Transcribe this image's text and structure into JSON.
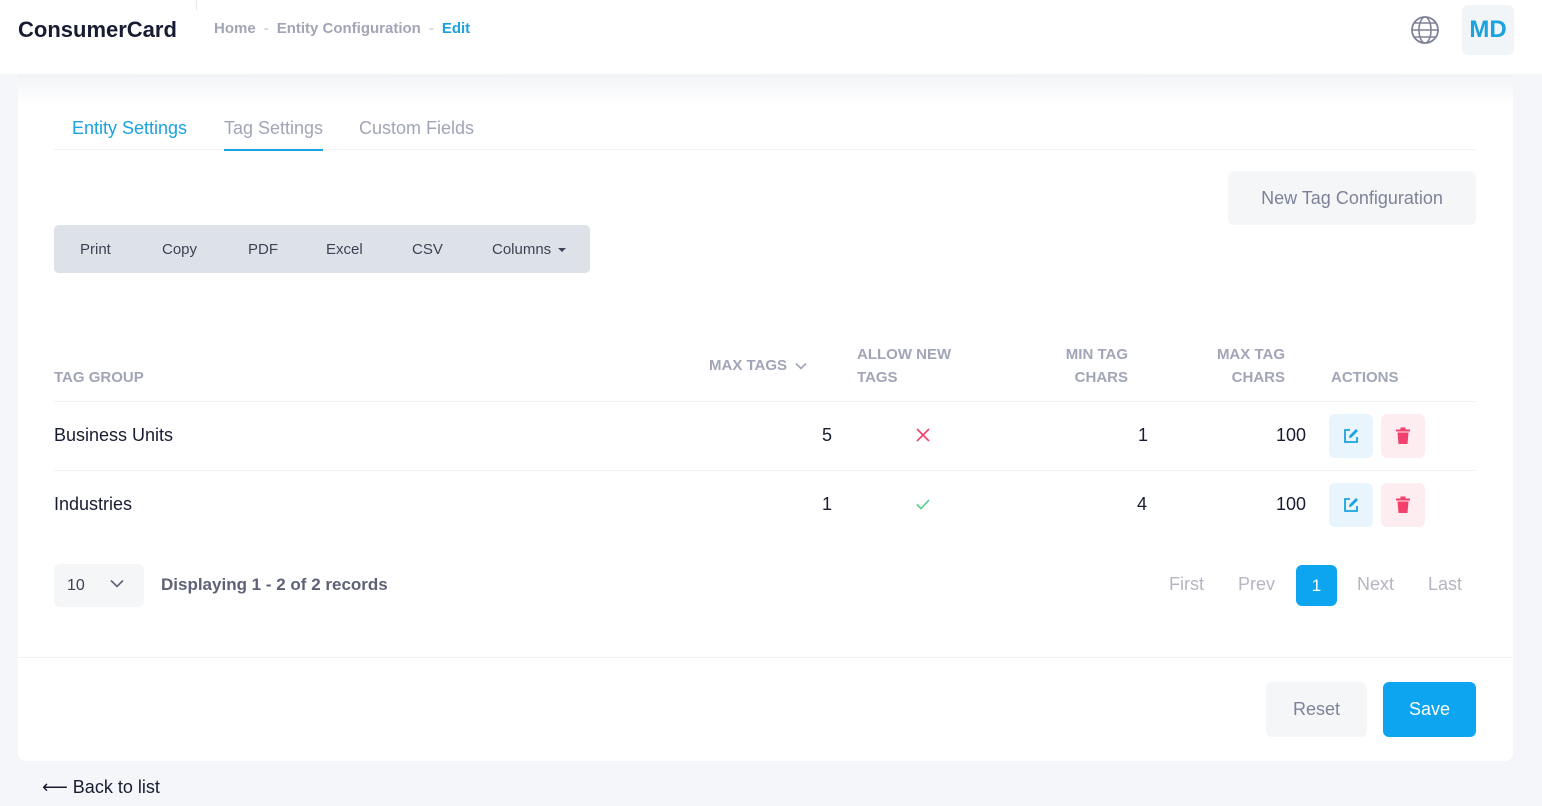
{
  "header": {
    "brand": "ConsumerCard",
    "breadcrumb": [
      "Home",
      "Entity Configuration",
      "Edit"
    ],
    "globe_icon": "globe-icon",
    "avatar_initials": "MD"
  },
  "tabs": [
    {
      "label": "Entity Settings"
    },
    {
      "label": "Tag Settings"
    },
    {
      "label": "Custom Fields"
    }
  ],
  "toolbar": {
    "new_button": "New Tag Configuration",
    "export_buttons": [
      "Print",
      "Copy",
      "PDF",
      "Excel",
      "CSV",
      "Columns"
    ]
  },
  "table": {
    "headers": {
      "tag_group": "TAG GROUP",
      "max_tags": "MAX TAGS",
      "allow_new_tags_1": "ALLOW NEW",
      "allow_new_tags_2": "TAGS",
      "min_tag_chars_1": "MIN TAG",
      "min_tag_chars_2": "CHARS",
      "max_tag_chars_1": "MAX TAG",
      "max_tag_chars_2": "CHARS",
      "actions": "ACTIONS"
    },
    "rows": [
      {
        "tag_group": "Business Units",
        "max_tags": "5",
        "allow_new_tags": false,
        "min_tag_chars": "1",
        "max_tag_chars": "100"
      },
      {
        "tag_group": "Industries",
        "max_tags": "1",
        "allow_new_tags": true,
        "min_tag_chars": "4",
        "max_tag_chars": "100"
      }
    ]
  },
  "pagination": {
    "page_size": "10",
    "records_text": "Displaying 1 - 2 of 2 records",
    "first": "First",
    "prev": "Prev",
    "current": "1",
    "next": "Next",
    "last": "Last"
  },
  "footer": {
    "reset": "Reset",
    "save": "Save",
    "back_link": "⟵ Back to list"
  },
  "colors": {
    "accent": "#0ea5f0",
    "link": "#1ba2e0",
    "danger": "#f1416c",
    "success": "#50cd89"
  }
}
